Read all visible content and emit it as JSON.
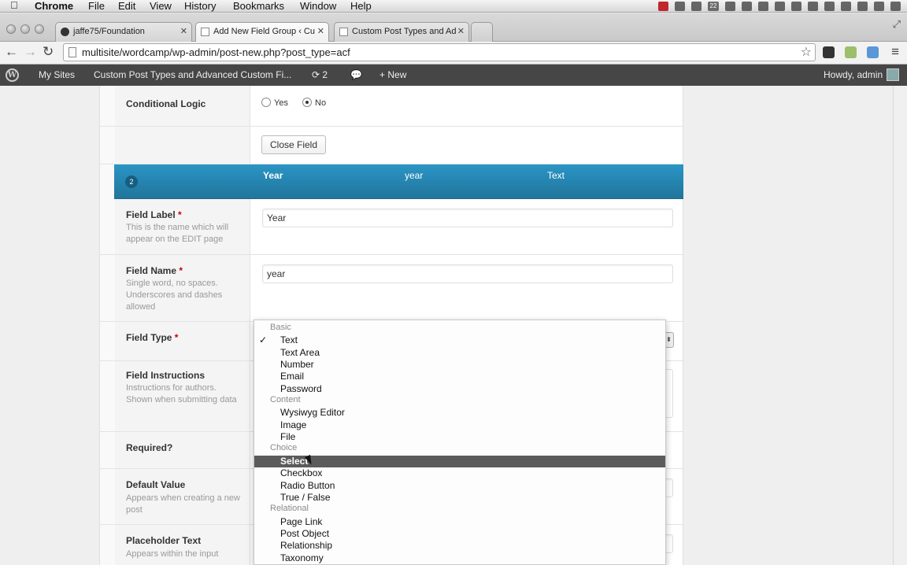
{
  "menubar": {
    "app": "Chrome",
    "items": [
      "File",
      "Edit",
      "View",
      "History",
      "Bookmarks",
      "Window",
      "Help"
    ],
    "tray_number": "22"
  },
  "tabs": [
    {
      "label": "jaffe75/Foundation",
      "icon": "github-icon"
    },
    {
      "label": "Add New Field Group ‹ Cu",
      "icon": "page-icon",
      "active": true
    },
    {
      "label": "Custom Post Types and Ad",
      "icon": "page-icon"
    }
  ],
  "toolbar": {
    "url": "multisite/wordcamp/wp-admin/post-new.php?post_type=acf"
  },
  "adminbar": {
    "my_sites": "My Sites",
    "site_name": "Custom Post Types and Advanced Custom Fi...",
    "updates_count": "2",
    "new_label": "New",
    "greeting": "Howdy, admin"
  },
  "field1": {
    "conditional_logic": {
      "label": "Conditional Logic",
      "yes": "Yes",
      "no": "No",
      "selected": "No"
    },
    "close_button": "Close Field"
  },
  "field2": {
    "order": "2",
    "header": {
      "label": "Year",
      "name": "year",
      "type": "Text"
    },
    "field_label": {
      "label": "Field Label",
      "required_mark": "*",
      "desc": "This is the name which will appear on the EDIT page",
      "value": "Year"
    },
    "field_name": {
      "label": "Field Name",
      "required_mark": "*",
      "desc": "Single word, no spaces. Underscores and dashes allowed",
      "value": "year"
    },
    "field_type": {
      "label": "Field Type",
      "required_mark": "*"
    },
    "field_instructions": {
      "label": "Field Instructions",
      "desc": "Instructions for authors. Shown when submitting data"
    },
    "required": {
      "label": "Required?"
    },
    "default_value": {
      "label": "Default Value",
      "desc": "Appears when creating a new post"
    },
    "placeholder_text": {
      "label": "Placeholder Text",
      "desc": "Appears within the input"
    }
  },
  "dropdown": {
    "checked": "Text",
    "highlighted": "Select",
    "groups": [
      {
        "label": "Basic",
        "options": [
          "Text",
          "Text Area",
          "Number",
          "Email",
          "Password"
        ]
      },
      {
        "label": "Content",
        "options": [
          "Wysiwyg Editor",
          "Image",
          "File"
        ]
      },
      {
        "label": "Choice",
        "options": [
          "Select",
          "Checkbox",
          "Radio Button",
          "True / False"
        ]
      },
      {
        "label": "Relational",
        "options": [
          "Page Link",
          "Post Object",
          "Relationship",
          "Taxonomy"
        ]
      }
    ]
  },
  "colors": {
    "field_header": "#21759b",
    "admin_bar": "#464646",
    "dropdown_highlight": "#5b5b5b",
    "required": "#cc0000"
  }
}
